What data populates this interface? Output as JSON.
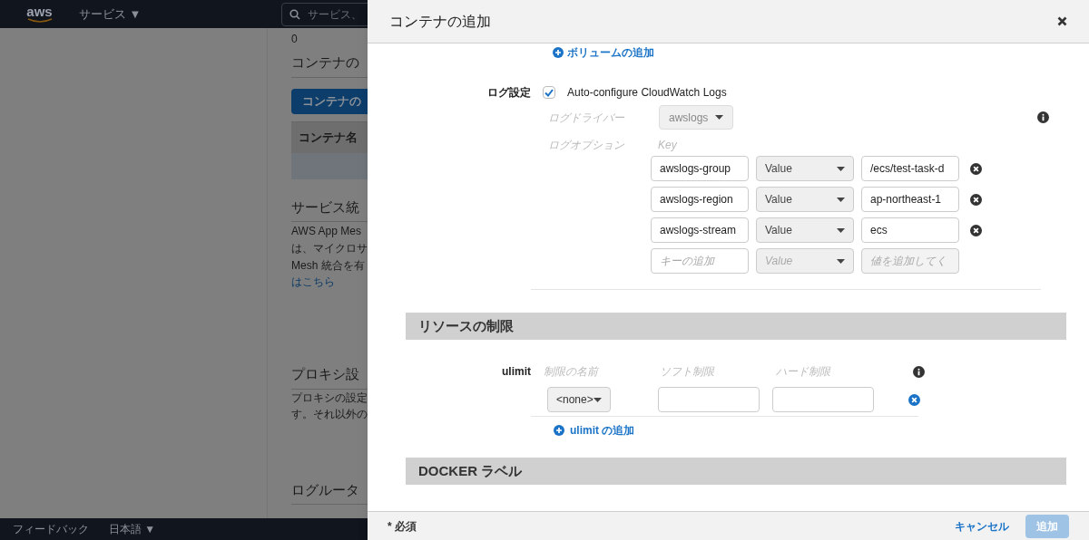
{
  "top_nav": {
    "logo": "aws",
    "services_menu": "サービス ▼",
    "search": {
      "placeholder": "サービス、"
    }
  },
  "background_page": {
    "count": "0",
    "container_heading": "コンテナの",
    "add_container_button": "コンテナの",
    "table": {
      "columns": [
        "コンテナ名"
      ]
    },
    "service_heading": "サービス統",
    "service_text_lines": [
      "AWS App Mes",
      "は、マイクロサ",
      "Mesh 統合を有"
    ],
    "service_link": "はこちら",
    "proxy_heading": "プロキシ設",
    "proxy_text_lines": [
      "プロキシの設定",
      "す。それ以外の"
    ],
    "log_router_heading": "ログルータ"
  },
  "footer": {
    "feedback": "フィードバック",
    "language": "日本語 ▼"
  },
  "modal": {
    "title": "コンテナの追加",
    "add_volume_link": "ボリュームの追加",
    "log_settings": {
      "label": "ログ設定",
      "auto_configure": {
        "label": "Auto-configure CloudWatch Logs",
        "checked": true
      },
      "driver_label": "ログドライバー",
      "driver": "awslogs",
      "options_label": "ログオプション",
      "key_header": "Key",
      "options": [
        {
          "kind": "entry",
          "key": "awslogs-group",
          "type": "Value",
          "value": "/ecs/test-task-d"
        },
        {
          "kind": "entry",
          "key": "awslogs-region",
          "type": "Value",
          "value": "ap-northeast-1"
        },
        {
          "kind": "entry",
          "key": "awslogs-stream",
          "type": "Value",
          "value": "ecs"
        },
        {
          "kind": "new",
          "key_placeholder": "キーの追加",
          "type": "Value",
          "value_placeholder": "値を追加してく"
        }
      ]
    },
    "resource_limits": {
      "title": "リソースの制限",
      "ulimit_label": "ulimit",
      "columns": [
        "制限の名前",
        "ソフト制限",
        "ハード制限"
      ],
      "rows": [
        {
          "name": "<none>",
          "soft": "",
          "hard": ""
        }
      ],
      "add_link": "ulimit の追加"
    },
    "docker_labels": {
      "title": "DOCKER ラベル"
    },
    "required_note": "* 必須",
    "cancel": "キャンセル",
    "submit": {
      "label": "追加",
      "disabled": true
    }
  }
}
